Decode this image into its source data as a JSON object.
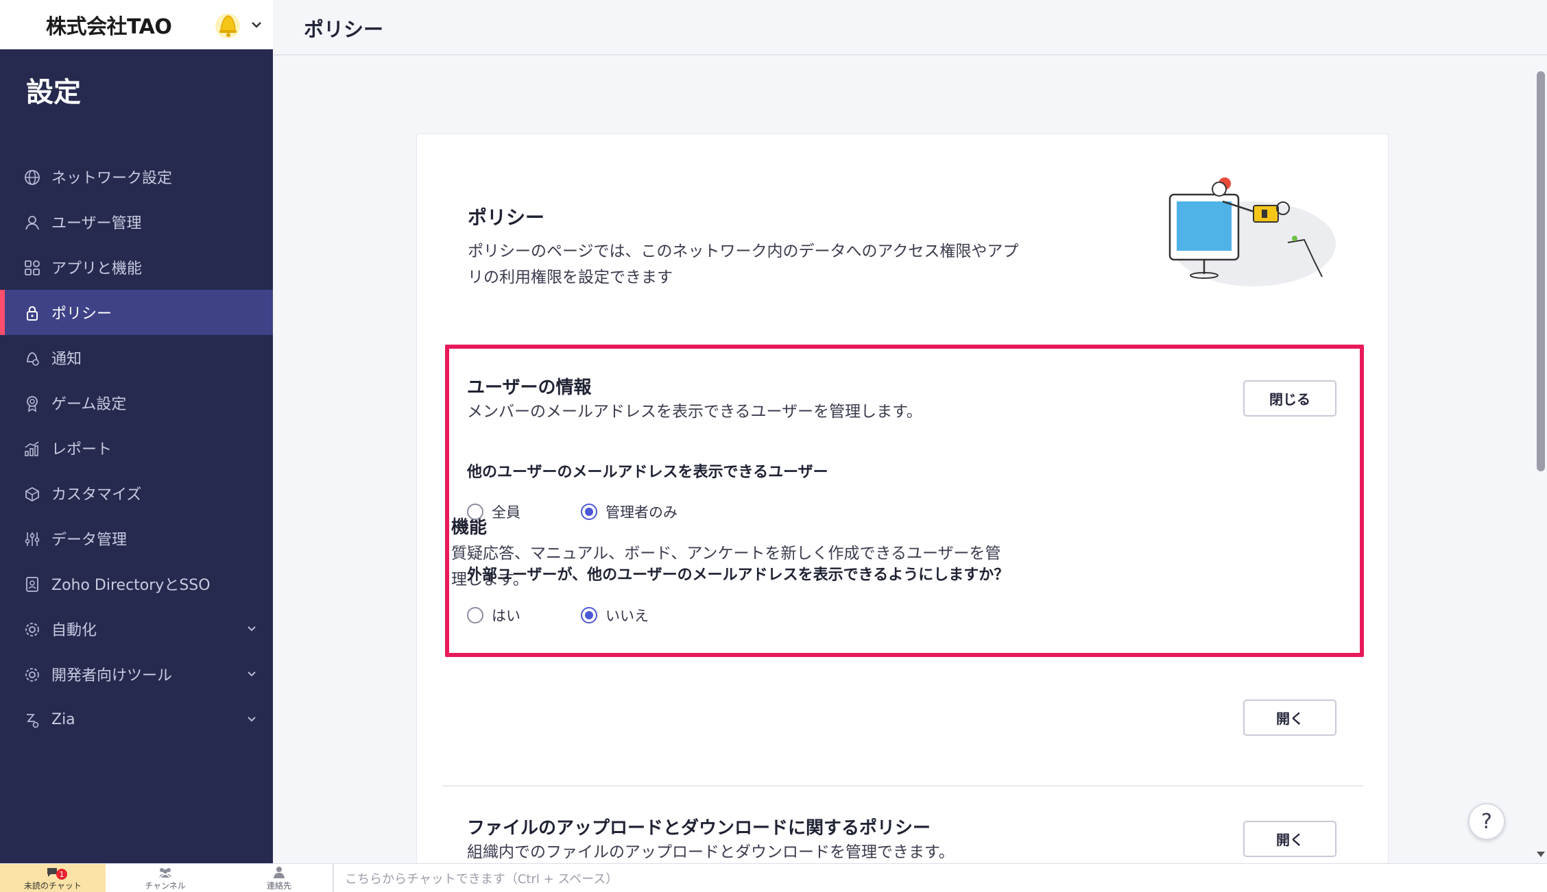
{
  "org": {
    "name": "株式会社TAO"
  },
  "header": {
    "title": "ポリシー"
  },
  "sidebar": {
    "heading": "設定",
    "items": [
      {
        "label": "ネットワーク設定",
        "icon": "globe-icon"
      },
      {
        "label": "ユーザー管理",
        "icon": "user-icon"
      },
      {
        "label": "アプリと機能",
        "icon": "apps-icon"
      },
      {
        "label": "ポリシー",
        "icon": "lock-icon",
        "active": true
      },
      {
        "label": "通知",
        "icon": "notification-icon"
      },
      {
        "label": "ゲーム設定",
        "icon": "badge-icon"
      },
      {
        "label": "レポート",
        "icon": "report-icon"
      },
      {
        "label": "カスタマイズ",
        "icon": "customize-icon"
      },
      {
        "label": "データ管理",
        "icon": "sliders-icon"
      },
      {
        "label": "Zoho DirectoryとSSO",
        "icon": "directory-icon"
      },
      {
        "label": "自動化",
        "icon": "gear-icon",
        "expandable": true
      },
      {
        "label": "開発者向けツール",
        "icon": "gear-icon",
        "expandable": true
      },
      {
        "label": "Zia",
        "icon": "zia-icon",
        "expandable": true
      }
    ]
  },
  "hero": {
    "title": "ポリシー",
    "description_line1": "ポリシーのページでは、このネットワーク内のデータへのアクセス権限やアプ",
    "description_line2": "リの利用権限を設定できます"
  },
  "user_info": {
    "title": "ユーザーの情報",
    "description": "メンバーのメールアドレスを表示できるユーザーを管理します。",
    "button": "閉じる",
    "q1": {
      "title": "他のユーザーのメールアドレスを表示できるユーザー",
      "options": [
        "全員",
        "管理者のみ"
      ],
      "selected": "管理者のみ"
    },
    "q2": {
      "title": "外部ユーザーが、他のユーザーのメールアドレスを表示できるようにしますか？",
      "options": [
        "はい",
        "いいえ"
      ],
      "selected": "いいえ"
    }
  },
  "features": {
    "title": "機能",
    "description_line1": "質疑応答、マニュアル、ボード、アンケートを新しく作成できるユーザーを管",
    "description_line2": "理します。",
    "button": "開く"
  },
  "files": {
    "title": "ファイルのアップロードとダウンロードに関するポリシー",
    "description": "組織内でのファイルのアップロードとダウンロードを管理できます。",
    "button": "開く"
  },
  "help": {
    "label": "?"
  },
  "chatbar": {
    "unread_label": "未読のチャット",
    "unread_count": "1",
    "channels_label": "チャンネル",
    "contacts_label": "連絡先",
    "input_placeholder": "こちらからチャットできます（Ctrl + スペース）"
  },
  "colors": {
    "sidebar_bg": "#262a4f",
    "sidebar_active": "#3f4287",
    "accent_bar": "#ff4d6d",
    "highlight_border": "#e8195a",
    "radio_selected": "#4b57d6"
  }
}
